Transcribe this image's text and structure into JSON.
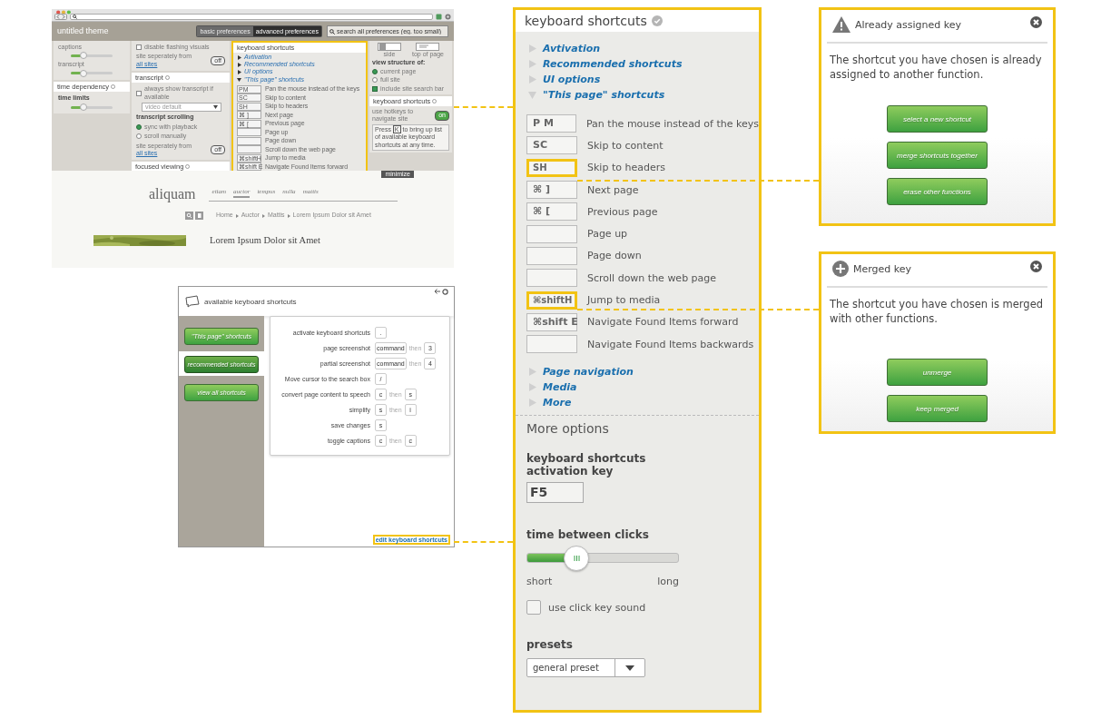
{
  "mini_browser": {
    "theme_title": "untitled theme",
    "mode_tabs": [
      {
        "label": "basic preferences",
        "selected": false
      },
      {
        "label": "advanced preferences",
        "selected": true
      }
    ],
    "search_placeholder": "search all preferences (eg. too small)",
    "columns": [
      {
        "cards": [
          {
            "items": [
              {
                "kind": "slider",
                "label": "captions",
                "level": 0.3
              },
              {
                "kind": "slider",
                "label": "transcript",
                "level": 0.3
              }
            ]
          },
          {
            "title": "time dependency",
            "items": [
              {
                "kind": "label",
                "text": "time limits"
              },
              {
                "kind": "slider",
                "level": 0.3
              }
            ]
          }
        ]
      },
      {
        "cards": [
          {
            "items": [
              {
                "kind": "checkbox",
                "label": "disable flashing visuals",
                "checked": false
              },
              {
                "kind": "toggle",
                "label": "site seperately from",
                "link": "all sites",
                "state": "off",
                "on": false
              }
            ]
          },
          {
            "title": "transcript",
            "items": [
              {
                "kind": "checkbox",
                "label": "always show transcript if available",
                "checked": false
              },
              {
                "kind": "select",
                "value": "video default"
              },
              {
                "kind": "label",
                "text": "transcript scrolling"
              },
              {
                "kind": "radio",
                "label": "sync with playback",
                "selected": true
              },
              {
                "kind": "radio",
                "label": "scroll manually",
                "selected": false
              },
              {
                "kind": "toggle",
                "label": "site seperately from",
                "link": "all sites",
                "state": "off",
                "on": false
              }
            ]
          },
          {
            "title": "focused viewing"
          }
        ]
      }
    ],
    "shortcuts_panel": {
      "title": "keyboard shortcuts",
      "sections": [
        {
          "label": "Avtivation",
          "expanded": false
        },
        {
          "label": "Recommended shortcuts",
          "expanded": false
        },
        {
          "label": "UI options",
          "expanded": false
        },
        {
          "label": "\"This page\" shortcuts",
          "expanded": true
        }
      ],
      "rows": [
        {
          "key": "PM",
          "label": "Pan the mouse instead of the keys"
        },
        {
          "key": "SC",
          "label": "Skip to content"
        },
        {
          "key": "SH",
          "label": "Skip to headers"
        },
        {
          "key": "⌘ ]",
          "label": "Next page"
        },
        {
          "key": "⌘ [",
          "label": "Previous page"
        },
        {
          "label": "Page up"
        },
        {
          "label": "Page down"
        },
        {
          "label": "Scroll down the web page"
        },
        {
          "key": "⌘shiftH",
          "label": "Jump to media"
        },
        {
          "key": "⌘shift E",
          "label": "Navigate Found Items forward"
        }
      ]
    },
    "right_column": {
      "cards": [
        {
          "items": [
            {
              "kind": "thumbs",
              "labels": [
                "side",
                "top of page"
              ]
            },
            {
              "kind": "label",
              "text": "view structure of:"
            },
            {
              "kind": "radio",
              "label": "current page",
              "selected": true
            },
            {
              "kind": "radio",
              "label": "full site",
              "selected": false
            },
            {
              "kind": "checkbox",
              "label": "include site search bar",
              "checked": true
            }
          ]
        },
        {
          "title": "keyboard shortcuts",
          "items": [
            {
              "kind": "toggle",
              "label": "use hotkeys to navigate site",
              "state": "on",
              "on": true
            },
            {
              "kind": "note",
              "before": "Press",
              "key": "K",
              "after": "to bring up list of available keyboard shortcuts at any time."
            }
          ]
        }
      ]
    },
    "minimize_tab": "minimize",
    "page": {
      "logo": "aliquam",
      "nav": [
        {
          "label": "etiam",
          "selected": false
        },
        {
          "label": "auctor",
          "selected": true
        },
        {
          "label": "tempus",
          "selected": false
        },
        {
          "label": "nulla",
          "selected": false
        },
        {
          "label": "mattis",
          "selected": false
        }
      ],
      "breadcrumb": [
        "Home",
        "Auctor",
        "Mattis",
        "Lorem Ipsum Dolor sit Amet"
      ],
      "heading": "Lorem Ipsum Dolor sit Amet"
    }
  },
  "shortcuts_dialog": {
    "title": "available keyboard shortcuts",
    "tabs": [
      {
        "label": "\"This page\" shortcuts",
        "selected": false
      },
      {
        "label": "recommended shortcuts",
        "selected": true
      },
      {
        "label": "view all shortcuts",
        "selected": false
      }
    ],
    "rows": [
      {
        "label": "activate keyboard shortcuts",
        "keys": [
          "."
        ]
      },
      {
        "label": "page screenshot",
        "keys": [
          "command",
          "3"
        ],
        "joiner": "then"
      },
      {
        "label": "partial screenshot",
        "keys": [
          "command",
          "4"
        ],
        "joiner": "then"
      },
      {
        "label": "Move cursor to the search box",
        "keys": [
          "/"
        ]
      },
      {
        "label": "convert page content to speech",
        "keys": [
          "c",
          "s"
        ],
        "joiner": "then"
      },
      {
        "label": "simplify",
        "keys": [
          "s",
          "i"
        ],
        "joiner": "then"
      },
      {
        "label": "save changes",
        "keys": [
          "s"
        ]
      },
      {
        "label": "toggle captions",
        "keys": [
          "c",
          "c"
        ],
        "joiner": "then"
      }
    ],
    "edit_link": "edit keyboard shortcuts"
  },
  "settings_panel": {
    "title": "keyboard shortcuts",
    "sections_top": [
      {
        "label": "Avtivation",
        "expanded": false
      },
      {
        "label": "Recommended shortcuts",
        "expanded": false
      },
      {
        "label": "UI options",
        "expanded": false
      },
      {
        "label": "\"This page\" shortcuts",
        "expanded": true
      }
    ],
    "rows": [
      {
        "key": "P M",
        "label": "Pan the mouse instead of the keys",
        "highlighted": false
      },
      {
        "key": "SC",
        "label": "Skip to content",
        "highlighted": false
      },
      {
        "key": "SH",
        "label": "Skip to headers",
        "highlighted": true
      },
      {
        "key": "⌘ ]",
        "label": "Next page",
        "highlighted": false
      },
      {
        "key": "⌘ [",
        "label": "Previous page",
        "highlighted": false
      },
      {
        "label": "Page up",
        "highlighted": false
      },
      {
        "label": "Page down",
        "highlighted": false
      },
      {
        "label": "Scroll down the web page",
        "highlighted": false
      },
      {
        "key": "⌘shiftH",
        "label": "Jump to media",
        "highlighted": true
      },
      {
        "key": "⌘shift E",
        "label": "Navigate Found Items forward",
        "highlighted": false
      },
      {
        "label": "Navigate Found Items backwards",
        "highlighted": false
      }
    ],
    "sections_bottom": [
      {
        "label": "Page navigation",
        "expanded": false
      },
      {
        "label": "Media",
        "expanded": false
      },
      {
        "label": "More",
        "expanded": false
      }
    ],
    "more_title": "More options",
    "activation_label": "keyboard shortcuts activation key",
    "activation_value": "F5",
    "clicks_label": "time between clicks",
    "clicks_slider": {
      "level": 0.33,
      "min_label": "short",
      "max_label": "long"
    },
    "sound_checkbox": {
      "label": "use click key sound",
      "checked": false
    },
    "presets_label": "presets",
    "presets_value": "general preset"
  },
  "alerts": [
    {
      "kind": "warning",
      "title": "Already assigned key",
      "message": "The shortcut you have chosen is already assigned to another function.",
      "buttons": [
        "select a new shortcut",
        "merge shortcuts together",
        "erase other functions"
      ]
    },
    {
      "kind": "merged",
      "title": "Merged key",
      "message": "The shortcut you have chosen is merged with other functions.",
      "buttons": [
        "unmerge",
        "keep merged"
      ]
    }
  ]
}
